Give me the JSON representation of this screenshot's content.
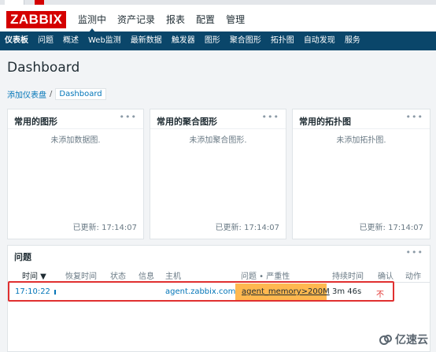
{
  "brand": {
    "logo_text": "ZABBIX",
    "accent": "#d40000",
    "nav_bg": "#0a466a"
  },
  "main_menu": [
    {
      "label": "监测中",
      "active": true
    },
    {
      "label": "资产记录"
    },
    {
      "label": "报表"
    },
    {
      "label": "配置"
    },
    {
      "label": "管理"
    }
  ],
  "sub_menu": [
    {
      "label": "仪表板",
      "active": true
    },
    {
      "label": "问题"
    },
    {
      "label": "概述"
    },
    {
      "label": "Web监测"
    },
    {
      "label": "最新数据"
    },
    {
      "label": "触发器"
    },
    {
      "label": "图形"
    },
    {
      "label": "聚合图形"
    },
    {
      "label": "拓扑图"
    },
    {
      "label": "自动发现"
    },
    {
      "label": "服务"
    }
  ],
  "page": {
    "title": "Dashboard"
  },
  "breadcrumb": {
    "link": "添加仪表盘",
    "separator": "/",
    "current": "Dashboard"
  },
  "widgets": [
    {
      "title": "常用的图形",
      "menu": "•••",
      "empty": "未添加数据图.",
      "updated": "已更新: 17:14:07"
    },
    {
      "title": "常用的聚合图形",
      "menu": "•••",
      "empty": "未添加聚合图形.",
      "updated": "已更新: 17:14:07"
    },
    {
      "title": "常用的拓扑图",
      "menu": "•••",
      "empty": "未添加拓扑图.",
      "updated": "已更新: 17:14:07"
    }
  ],
  "problems": {
    "title": "问题",
    "menu": "•••",
    "columns": {
      "time": "时间 ▼",
      "recovery": "恢复时间",
      "status": "状态",
      "info": "信息",
      "host": "主机",
      "problem": "问题 • 严重性",
      "duration": "持续时间",
      "ack": "确认",
      "actions": "动作"
    },
    "rows": [
      {
        "time": "17:10:22",
        "recovery": "",
        "status": "",
        "info": "",
        "host": "agent.zabbix.com",
        "problem": "agent_memory>200M",
        "severity_color": "#ffb84f",
        "duration": "3m 46s",
        "ack": "不",
        "actions": ""
      }
    ]
  },
  "watermark": {
    "text": "亿速云"
  }
}
